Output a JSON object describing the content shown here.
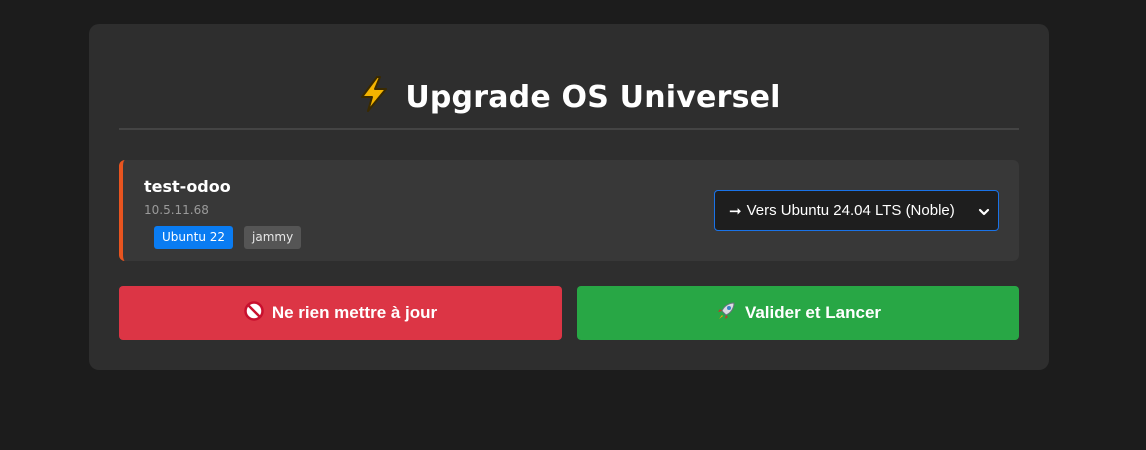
{
  "header": {
    "icon": "lightning-bolt-icon",
    "title": "Upgrade OS Universel"
  },
  "server": {
    "name": "test-odoo",
    "ip": "10.5.11.68",
    "os_badge": "Ubuntu 22",
    "codename_badge": "jammy",
    "accent_color": "#e8541f"
  },
  "target_select": {
    "arrow": "➞",
    "selected_label": "Vers Ubuntu 24.04 LTS (Noble)"
  },
  "actions": {
    "skip_label": "Ne rien mettre à jour",
    "skip_icon": "no-entry-icon",
    "skip_color": "#dc3545",
    "launch_label": "Valider et Lancer",
    "launch_icon": "rocket-icon",
    "launch_color": "#28a745"
  }
}
